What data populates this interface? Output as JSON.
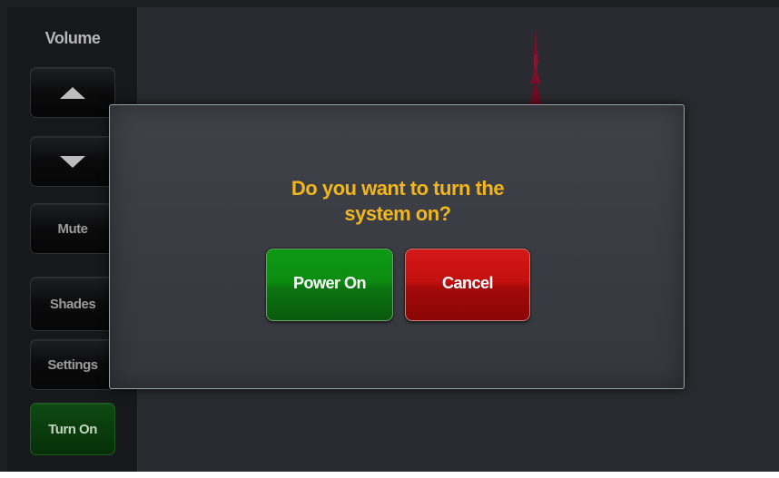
{
  "sidebar": {
    "volume_label": "Volume",
    "volume_up_icon": "triangle-up-icon",
    "volume_down_icon": "triangle-down-icon",
    "mute_label": "Mute",
    "shades_label": "Shades",
    "settings_label": "Settings",
    "turn_on_label": "Turn On"
  },
  "dialog": {
    "question_line1": "Do you want to turn the",
    "question_line2": "system on?",
    "power_on_label": "Power On",
    "cancel_label": "Cancel"
  },
  "colors": {
    "question_text": "#f1b61e",
    "power_on": "#0c8c12",
    "cancel": "#c41010",
    "turn_on_bg": "#093b0c"
  }
}
